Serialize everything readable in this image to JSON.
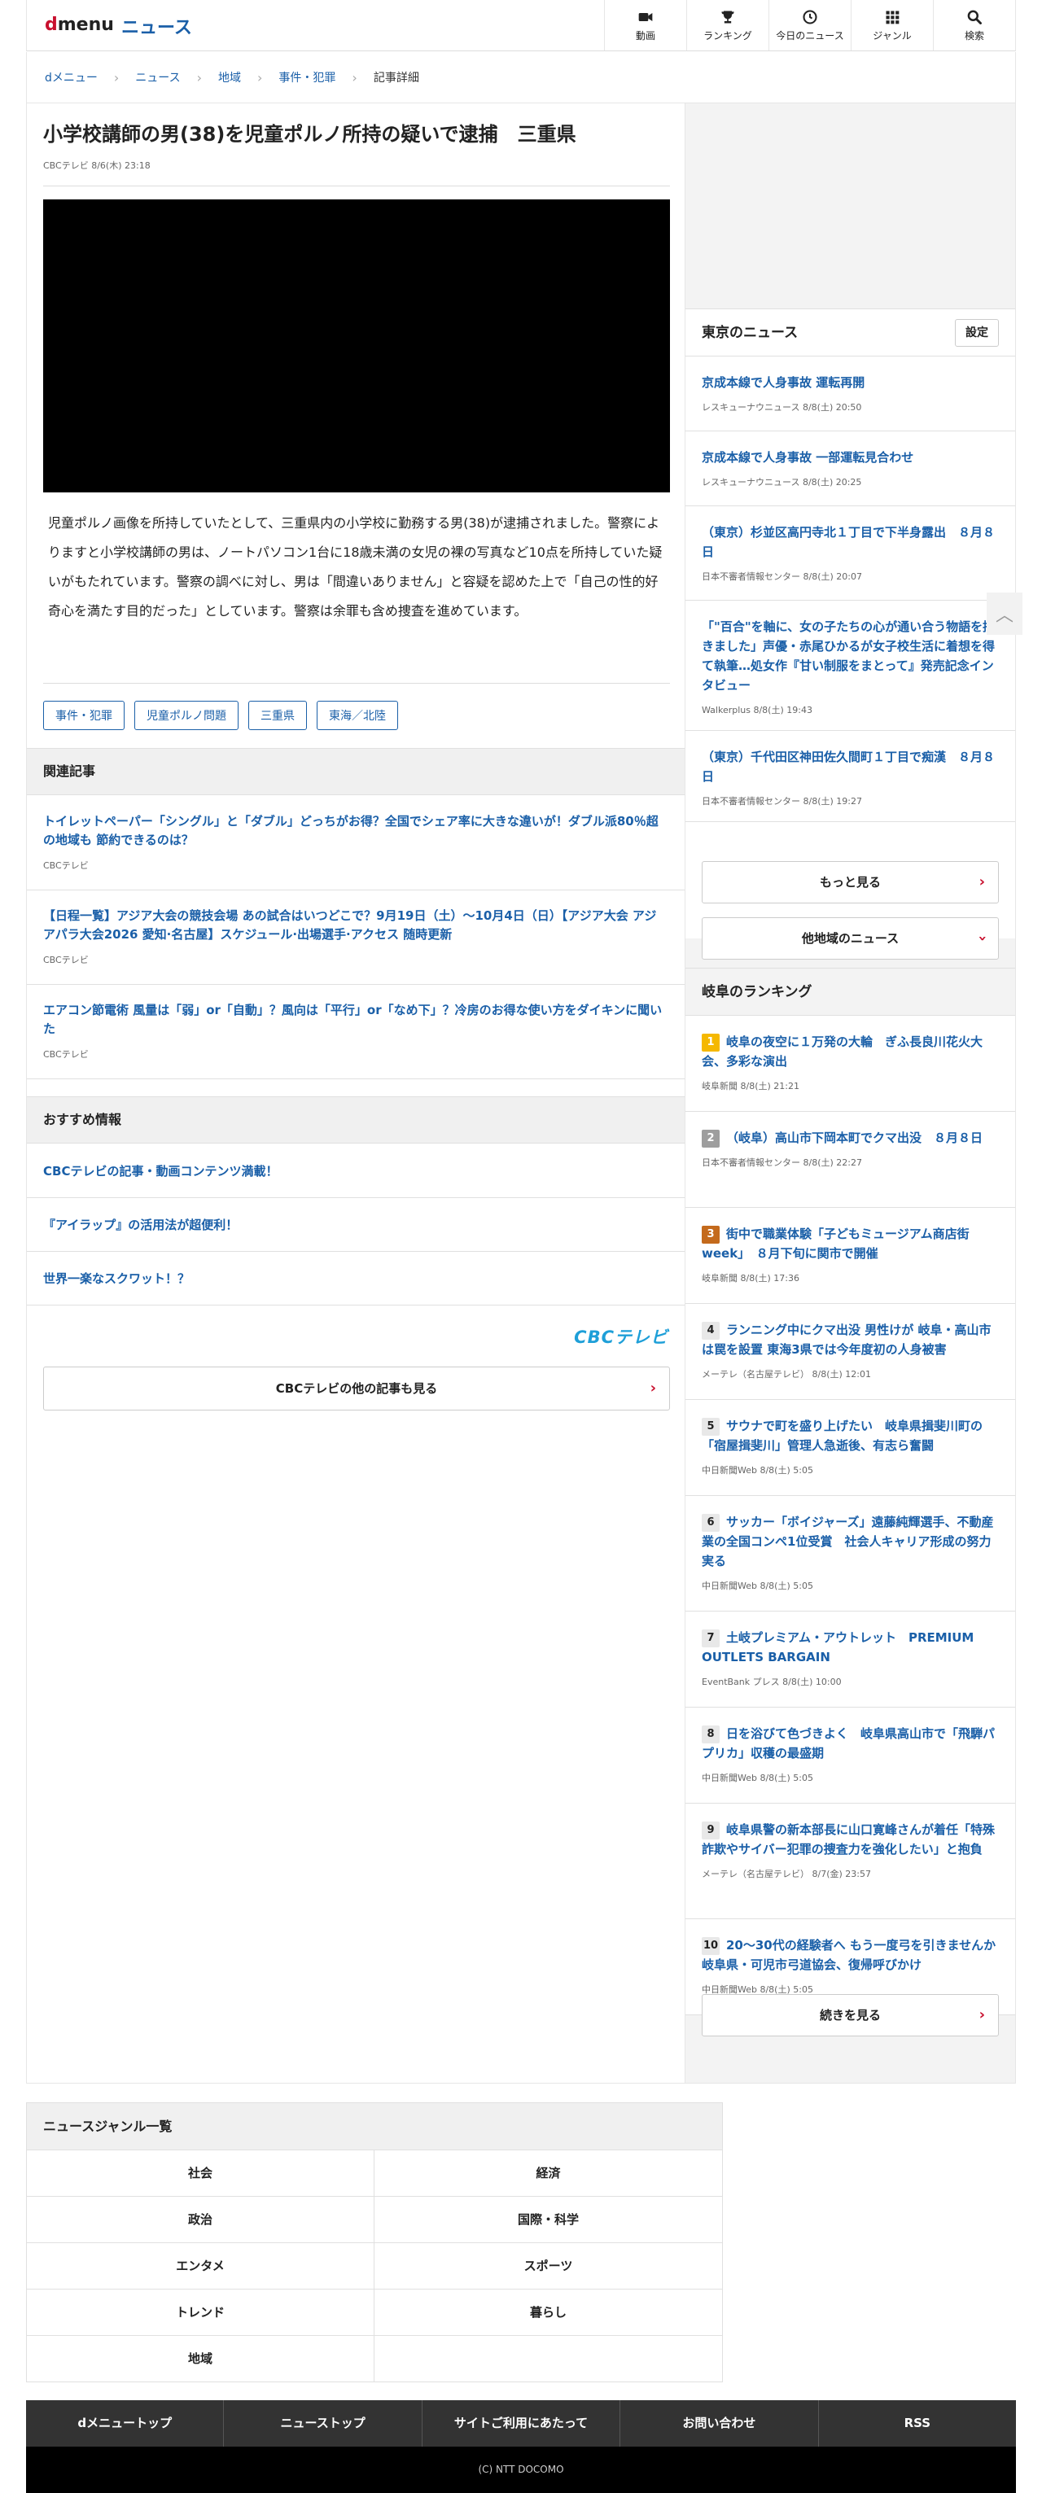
{
  "header": {
    "logo_d": "d",
    "logo_menu": "menu",
    "logo_news": "ニュース",
    "nav": [
      {
        "label": "動画",
        "icon": "video-camera-icon"
      },
      {
        "label": "ランキング",
        "icon": "trophy-icon"
      },
      {
        "label": "今日のニュース",
        "icon": "clock-icon"
      },
      {
        "label": "ジャンル",
        "icon": "grid-icon"
      },
      {
        "label": "検索",
        "icon": "search-icon"
      }
    ]
  },
  "breadcrumb": [
    "dメニュー",
    "ニュース",
    "地域",
    "事件・犯罪",
    "記事詳細"
  ],
  "article": {
    "title": "小学校講師の男(38)を児童ポルノ所持の疑いで逮捕　三重県",
    "meta": "CBCテレビ 8/6(木) 23:18",
    "body": "児童ポルノ画像を所持していたとして、三重県内の小学校に勤務する男(38)が逮捕されました。警察によりますと小学校講師の男は、ノートパソコン1台に18歳未満の女児の裸の写真など10点を所持していた疑いがもたれています。警察の調べに対し、男は「間違いありません」と容疑を認めた上で「自己の性的好奇心を満たす目的だった」としています。警察は余罪も含め捜査を進めています。",
    "tags": [
      "事件・犯罪",
      "児童ポルノ問題",
      "三重県",
      "東海／北陸"
    ]
  },
  "related": {
    "heading": "関連記事",
    "items": [
      {
        "title": "トイレットペーパー「シングル」と「ダブル」どっちがお得？全国でシェア率に大きな違いが！ダブル派80％超の地域も 節約できるのは？",
        "source": "CBCテレビ"
      },
      {
        "title": "【日程一覧】アジア大会の競技会場 あの試合はいつどこで？9月19日（土）〜10月4日（日）【アジア大会 アジアパラ大会2026 愛知·名古屋】スケジュール·出場選手·アクセス 随時更新",
        "source": "CBCテレビ"
      },
      {
        "title": "エアコン節電術 風量は「弱」or「自動」？風向は「平行」or「なめ下」？冷房のお得な使い方をダイキンに聞いた",
        "source": "CBCテレビ"
      }
    ]
  },
  "recommend": {
    "heading": "おすすめ情報",
    "items": [
      "CBCテレビの記事・動画コンテンツ満載！",
      "『アイラップ』の活用法が超便利！",
      "世界一楽なスクワット！？"
    ]
  },
  "provider_logo": "CBCテレビ",
  "more_from_provider": "CBCテレビの他の記事も見る",
  "tokyo_news": {
    "heading": "東京のニュース",
    "settings": "設定",
    "items": [
      {
        "title": "京成本線で人身事故 運転再開",
        "source": "レスキューナウニュース 8/8(土) 20:50"
      },
      {
        "title": "京成本線で人身事故 一部運転見合わせ",
        "source": "レスキューナウニュース 8/8(土) 20:25"
      },
      {
        "title": "（東京）杉並区高円寺北１丁目で下半身露出　８月８日",
        "source": "日本不審者情報センター 8/8(土) 20:07"
      },
      {
        "title": "「\"百合\"を軸に、女の子たちの心が通い合う物語を描きました」声優・赤尾ひかるが女子校生活に着想を得て執筆…処女作『甘い制服をまとって』発売記念インタビュー",
        "source": "Walkerplus 8/8(土) 19:43"
      },
      {
        "title": "（東京）千代田区神田佐久間町１丁目で痴漢　８月８日",
        "source": "日本不審者情報センター 8/8(土) 19:27"
      }
    ],
    "more": "もっと見る",
    "other_regions": "他地域のニュース"
  },
  "gifu_ranking": {
    "heading": "岐阜のランキング",
    "items": [
      {
        "rank": "1",
        "title": "岐阜の夜空に１万発の大輪　ぎふ長良川花火大会、多彩な演出",
        "source": "岐阜新聞 8/8(土) 21:21"
      },
      {
        "rank": "2",
        "title": "（岐阜）高山市下岡本町でクマ出没　８月８日",
        "source": "日本不審者情報センター 8/8(土) 22:27"
      },
      {
        "rank": "3",
        "title": "街中で職業体験「子どもミュージアム商店街week」　８月下旬に関市で開催",
        "source": "岐阜新聞 8/8(土) 17:36"
      },
      {
        "rank": "4",
        "title": "ランニング中にクマ出没 男性けが 岐阜・高山市は罠を設置 東海3県では今年度初の人身被害",
        "source": "メーテレ（名古屋テレビ） 8/8(土) 12:01"
      },
      {
        "rank": "5",
        "title": "サウナで町を盛り上げたい　岐阜県揖斐川町の「宿屋揖斐川」管理人急逝後、有志ら奮闘",
        "source": "中日新聞Web 8/8(土) 5:05"
      },
      {
        "rank": "6",
        "title": "サッカー「ボイジャーズ」遠藤純輝選手、不動産業の全国コンペ1位受賞　社会人キャリア形成の努力実る",
        "source": "中日新聞Web 8/8(土) 5:05"
      },
      {
        "rank": "7",
        "title": "土岐プレミアム・アウトレット　PREMIUM OUTLETS BARGAIN",
        "source": "EventBank プレス 8/8(土) 10:00"
      },
      {
        "rank": "8",
        "title": "日を浴びて色づきよく　岐阜県高山市で「飛騨パプリカ」収穫の最盛期",
        "source": "中日新聞Web 8/8(土) 5:05"
      },
      {
        "rank": "9",
        "title": "岐阜県警の新本部長に山口寛峰さんが着任「特殊詐欺やサイバー犯罪の捜査力を強化したい」と抱負",
        "source": "メーテレ（名古屋テレビ） 8/7(金) 23:57"
      },
      {
        "rank": "10",
        "title": "20〜30代の経験者へ もう一度弓を引きませんか　岐阜県・可児市弓道協会、復帰呼びかけ",
        "source": "中日新聞Web 8/8(土) 5:05"
      }
    ],
    "continue": "続きを見る"
  },
  "genres": {
    "heading": "ニュースジャンル一覧",
    "items": [
      "社会",
      "経済",
      "政治",
      "国際・科学",
      "エンタメ",
      "スポーツ",
      "トレンド",
      "暮らし",
      "地域",
      ""
    ]
  },
  "footer": {
    "nav": [
      "dメニュートップ",
      "ニューストップ",
      "サイトご利用にあたって",
      "お問い合わせ",
      "RSS"
    ],
    "copyright": "(C) NTT DOCOMO"
  },
  "colors": {
    "link": "#1a5fa8",
    "brand_red": "#c8102e",
    "footer_dark": "#333333"
  }
}
